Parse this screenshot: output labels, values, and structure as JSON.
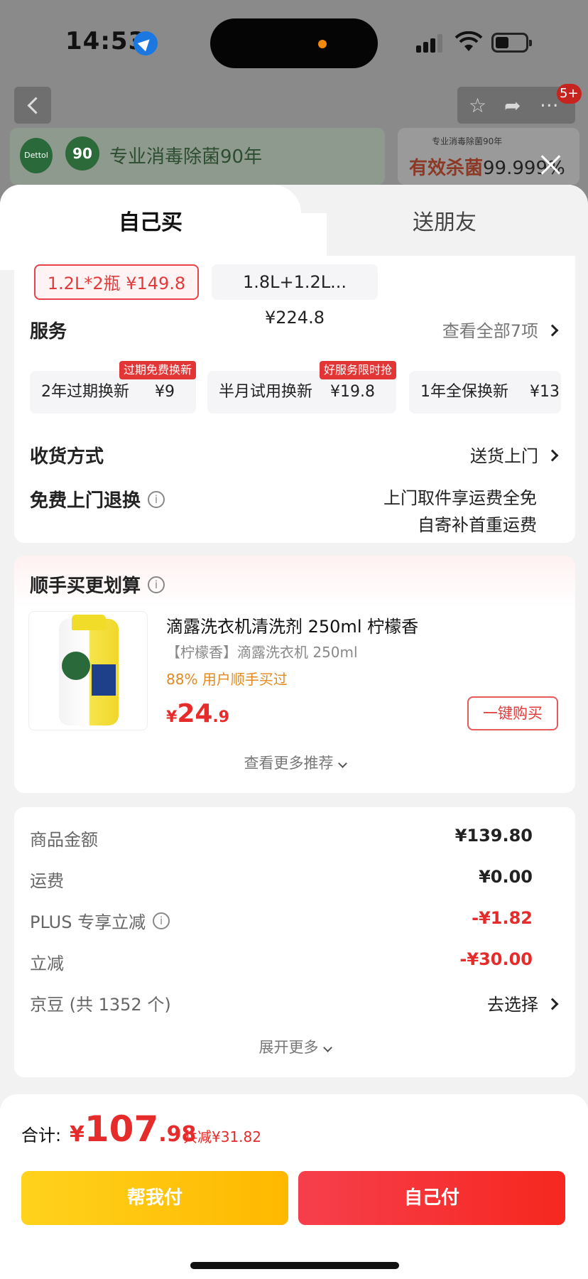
{
  "status": {
    "time": "14:53"
  },
  "background": {
    "badge_count": "5+",
    "banner_left_text": "专业消毒除菌90年",
    "banner_left_logo": "Dettol",
    "banner_left_90": "90",
    "banner_right_small": "专业消毒除菌90年",
    "banner_right_text": "有效杀菌",
    "banner_right_num": "99.999%"
  },
  "tabs": {
    "active": "自己买",
    "other": "送朋友"
  },
  "specs": [
    {
      "label": "1.2L*2瓶  ¥149.8",
      "selected": true
    },
    {
      "label": "1.8L+1.2L...  ¥224.8",
      "selected": false
    }
  ],
  "service": {
    "title": "服务",
    "view_all": "查看全部7项",
    "items": [
      {
        "name": "2年过期换新",
        "price": "¥9",
        "tag": "过期免费换新"
      },
      {
        "name": "半月试用换新",
        "price": "¥19.8",
        "tag": "好服务限时抢"
      },
      {
        "name": "1年全保换新",
        "price": "¥13",
        "tag": ""
      }
    ]
  },
  "delivery": {
    "label": "收货方式",
    "value": "送货上门"
  },
  "return": {
    "label": "免费上门退换",
    "line1": "上门取件享运费全免",
    "line2": "自寄补首重运费"
  },
  "addon": {
    "title": "顺手买更划算",
    "product_title": "滴露洗衣机清洗剂 250ml 柠檬香",
    "product_sub": "【柠檬香】滴露洗衣机 250ml",
    "product_meta": "88% 用户顺手买过",
    "price_symbol": "¥",
    "price_int": "24",
    "price_dec": ".9",
    "buy_label": "一键购买",
    "more_label": "查看更多推荐"
  },
  "fees": {
    "rows": [
      {
        "label": "商品金额",
        "value": "¥139.80"
      },
      {
        "label": "运费",
        "value": "¥0.00"
      },
      {
        "label": "PLUS 专享立减",
        "value": "-¥1.82"
      },
      {
        "label": "立减",
        "value": "-¥30.00"
      },
      {
        "label": "京豆 (共 1352 个)",
        "value": "去选择"
      }
    ],
    "expand_label": "展开更多"
  },
  "total": {
    "label": "合计:",
    "symbol": "¥",
    "int": "107",
    "dec": ".98",
    "saved": "共减¥31.82",
    "btn_help": "帮我付",
    "btn_self": "自己付"
  }
}
